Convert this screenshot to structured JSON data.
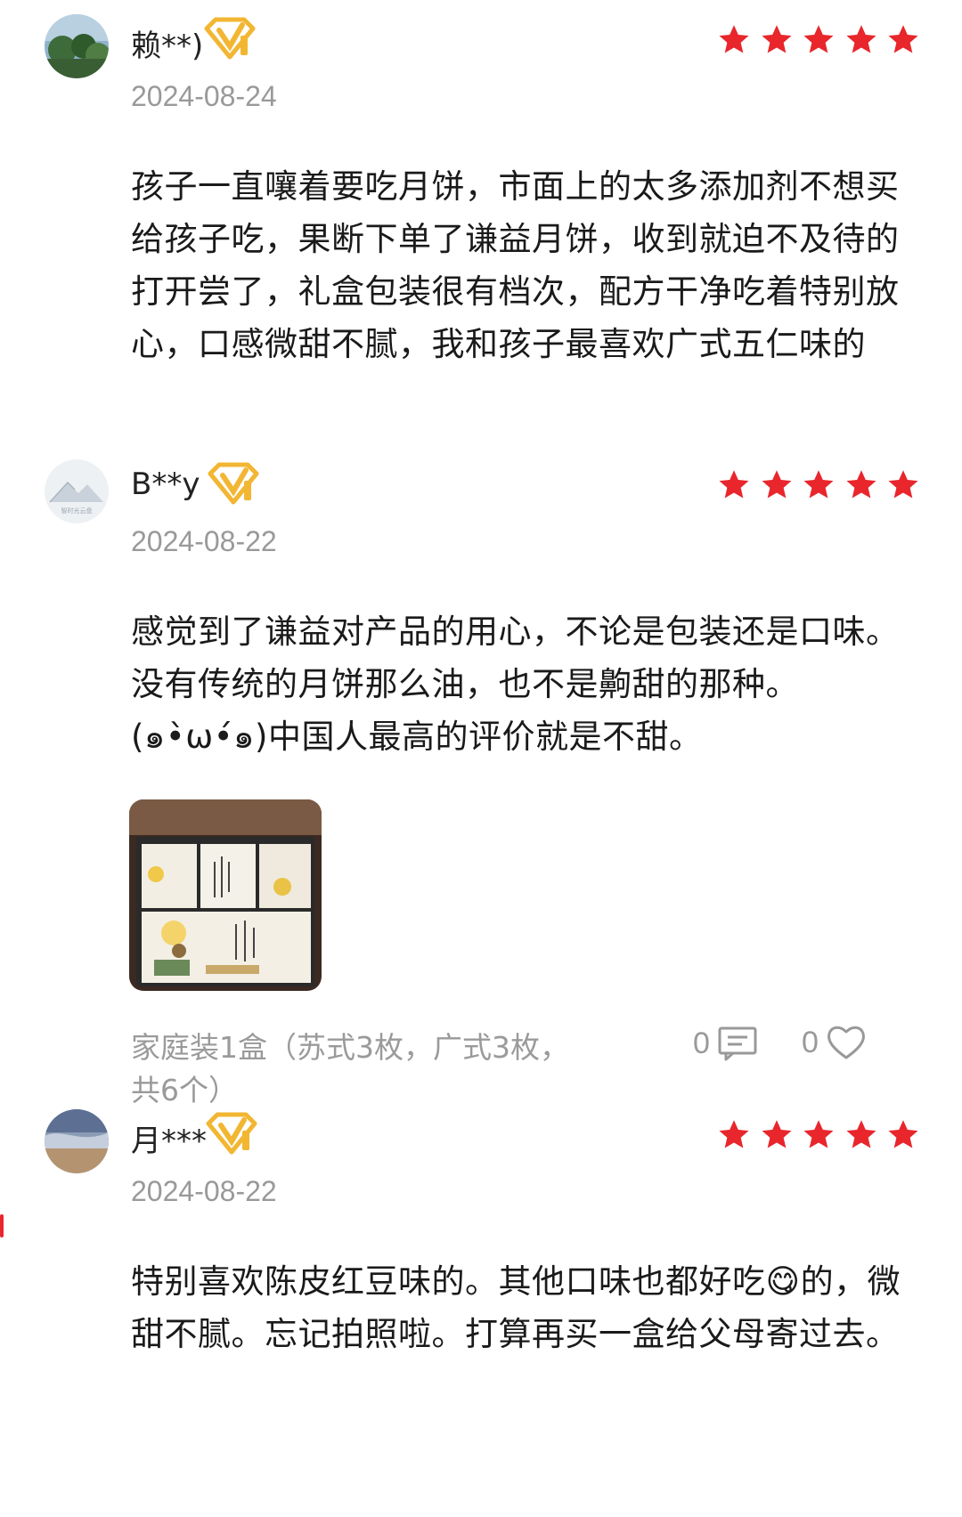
{
  "colors": {
    "star": "#e8262c",
    "vip": "#f2b632",
    "muted": "#999999"
  },
  "reviews": [
    {
      "avatar": "landscape-avatar",
      "username": "赖**)",
      "date": "2024-08-24",
      "rating": 5,
      "text": "孩子一直嚷着要吃月饼，市面上的太多添加剂不想买给孩子吃，果断下单了谦益月饼，收到就迫不及待的打开尝了，礼盒包装很有档次，配方干净吃着特别放心，口感微甜不腻，我和孩子最喜欢广式五仁味的"
    },
    {
      "avatar": "mountain-avatar",
      "avatar_caption": "智时光云盘",
      "username": "B**y",
      "date": "2024-08-22",
      "rating": 5,
      "text": "感觉到了谦益对产品的用心，不论是包装还是口味。没有传统的月饼那么油，也不是齁甜的那种。(๑•̀ω•́๑)中国人最高的评价就是不甜。",
      "photo": "mooncake-gift-box-photo",
      "spec": "家庭装1盒（苏式3枚，广式3枚，共6个）",
      "comments": "0",
      "likes": "0"
    },
    {
      "avatar": "sky-avatar",
      "username": "月***",
      "date": "2024-08-22",
      "rating": 5,
      "text": "特别喜欢陈皮红豆味的。其他口味也都好吃😋的，微甜不腻。忘记拍照啦。打算再买一盒给父母寄过去。"
    }
  ]
}
